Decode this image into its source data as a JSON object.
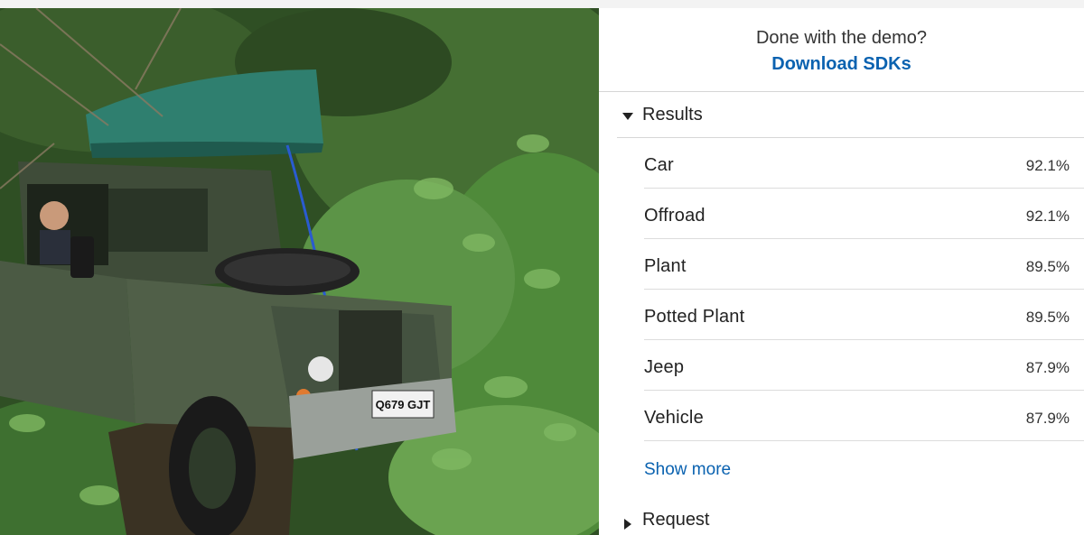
{
  "cta": {
    "question": "Done with the demo?",
    "link_label": "Download SDKs"
  },
  "results": {
    "title": "Results",
    "items": [
      {
        "label": "Car",
        "value": "92.1%"
      },
      {
        "label": "Offroad",
        "value": "92.1%"
      },
      {
        "label": "Plant",
        "value": "89.5%"
      },
      {
        "label": "Potted Plant",
        "value": "89.5%"
      },
      {
        "label": "Jeep",
        "value": "87.9%"
      },
      {
        "label": "Vehicle",
        "value": "87.9%"
      }
    ],
    "show_more_label": "Show more"
  },
  "request": {
    "title": "Request"
  },
  "photo": {
    "license_plate": "Q679 GJT",
    "colors": {
      "foliage": "#3f6b2e",
      "vehicle": "#4b5a44",
      "canoe": "#2f7f6f",
      "rope": "#2a5bd0"
    }
  },
  "theme": {
    "link_color": "#0a62b0",
    "divider_color": "#d6d6d6"
  }
}
